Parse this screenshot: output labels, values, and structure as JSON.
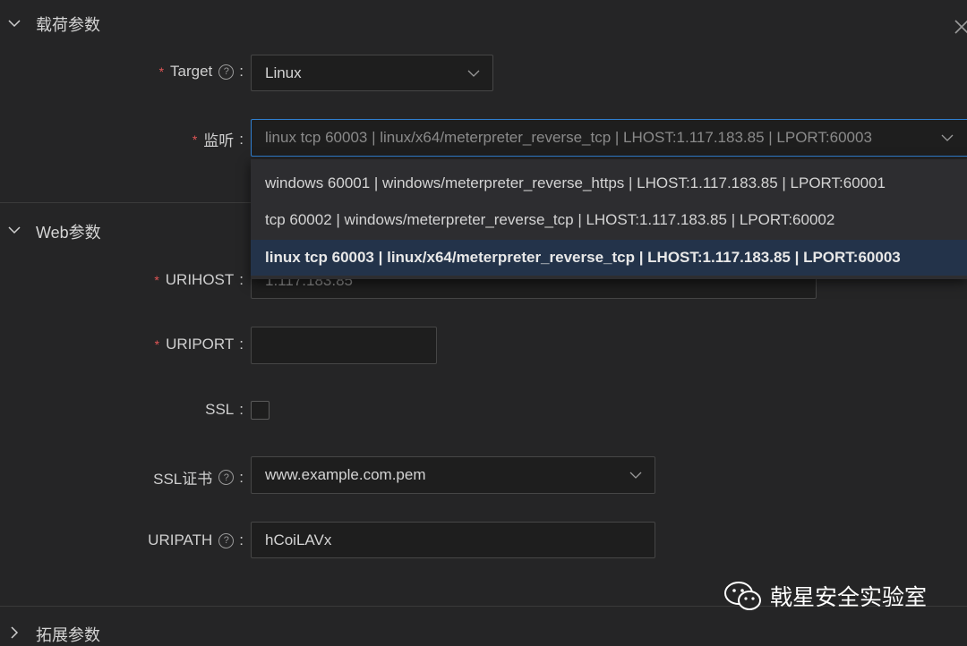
{
  "sections": {
    "payload": {
      "title": "载荷参数"
    },
    "web": {
      "title": "Web参数"
    },
    "extended": {
      "title": "拓展参数"
    }
  },
  "fields": {
    "target": {
      "label": "Target",
      "value": "Linux"
    },
    "listener": {
      "label": "监听",
      "value": "linux tcp 60003 | linux/x64/meterpreter_reverse_tcp | LHOST:1.117.183.85 | LPORT:60003"
    },
    "urihost": {
      "label": "URIHOST",
      "value": "1.117.183.85"
    },
    "uriport": {
      "label": "URIPORT",
      "value": ""
    },
    "ssl": {
      "label": "SSL",
      "checked": false
    },
    "ssl_cert": {
      "label": "SSL证书",
      "value": "www.example.com.pem"
    },
    "uripath": {
      "label": "URIPATH",
      "value": "hCoiLAVx"
    }
  },
  "colon": ":",
  "listener_options": [
    {
      "label": "windows 60001 | windows/meterpreter_reverse_https | LHOST:1.117.183.85 | LPORT:60001",
      "selected": false
    },
    {
      "label": "tcp 60002 | windows/meterpreter_reverse_tcp | LHOST:1.117.183.85 | LPORT:60002",
      "selected": false
    },
    {
      "label": "linux tcp 60003 | linux/x64/meterpreter_reverse_tcp | LHOST:1.117.183.85 | LPORT:60003",
      "selected": true
    }
  ],
  "watermark": {
    "text": "戟星安全实验室",
    "icon": "wechat-icon"
  },
  "icons": {
    "expand": "chevron-down-icon",
    "collapse": "chevron-right-icon",
    "help": "question-circle-icon",
    "close": "close-icon"
  },
  "colors": {
    "background": "#252526",
    "accent": "#2f7fd0",
    "required": "#e05555",
    "selected_option": "#23334a"
  }
}
